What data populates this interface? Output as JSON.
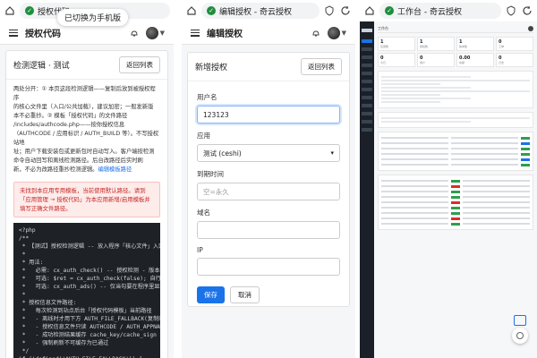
{
  "panel1": {
    "url_title": "授权代码",
    "toast": "已切换为手机版",
    "app_title": "授权代码",
    "card_title": "检测逻辑 · 测试",
    "back_label": "返回列表",
    "desc_line1": "两处分开：① 本页这段检测逻辑——复制后放到被授权程序",
    "desc_line2": "的核心文件里（入口/公共加载），建议加密；一般发新版",
    "desc_line3": "本不必重抄。② 模板「授权代码」的文件路径",
    "desc_line4": "/includes/authcode.php——按你授权信息",
    "desc_line5": "（AUTHCODE / 应用标识 / AUTH_BUILD 等）。不写授权站地",
    "desc_line6": "址；用户下载安装包或更新包时自动写入。客户端按检测",
    "desc_line7": "命令自动回写和离线检测路径。后台改路径后实时刷",
    "desc_line8": "新，不必为改路径重抄检测逻辑。",
    "desc_link": "编辑模板路径",
    "alert_text": "未找到本应用专用模板，当前使用默认路径。请到「应用管理 → 授权代码」为本应用新增/启用模板并填写正确文件路径。",
    "code_lines": [
      "<?php",
      "/**",
      " * 【测试】授权检测逻辑 -- 放入程序「核心文件」入口/公",
      " *",
      " * 用法:",
      " *   必需: cx_auth_check() -- 授权检测 - 版本检",
      " *   可选: $ret = cx_auth_check(false); 自行处",
      " *   可选: cx_auth_ads() -- 仅当勾要在程序里显示",
      " *",
      " * 授权信息文件路径:",
      " *   每次检测到站点后台「授权代码模板」当前路径",
      " *   - 离线时才用下方 AUTH_FILE_FALLBACK(复制时的路",
      " *   - 授权信息文件只读 AUTHCODE / AUTH_APPNAME /",
      " *   - 成功检测结果缓存 cache_key/cache_sign 本地",
      " *   - 强制刷新不可缓存为已通过",
      " */",
      "if (!defined('AUTH_FILE_FALLBACK')) {",
      "    define('AUTH_FILE_FALLBACK', 'includes/au"
    ]
  },
  "panel2": {
    "url_title": "编辑授权 - 奇云授权",
    "app_title": "编辑授权",
    "card_title": "新增授权",
    "back_label": "返回列表",
    "username_label": "用户名",
    "username_value": "123123",
    "app_label": "应用",
    "app_value": "测试 (ceshi)",
    "expire_label": "到期时间",
    "expire_placeholder": "空=永久",
    "domain_label": "域名",
    "domain_value": "",
    "ip_label": "IP",
    "ip_value": "",
    "save_label": "保存",
    "cancel_label": "取消"
  },
  "panel3": {
    "url_title": "工作台 - 奇云授权",
    "stats": [
      {
        "n": "1",
        "l": "应用数"
      },
      {
        "n": "1",
        "l": "授权数"
      },
      {
        "n": "1",
        "l": "版本数"
      },
      {
        "n": "0",
        "l": "工单"
      },
      {
        "n": "0",
        "l": "今日"
      },
      {
        "n": "0",
        "l": "用户"
      },
      {
        "n": "0.00",
        "l": "余额"
      },
      {
        "n": "0",
        "l": "日志"
      }
    ],
    "title": "工作台"
  },
  "colors": {
    "primary": "#1a73e8",
    "danger": "#c62828",
    "success": "#1e8e3e",
    "code_bg": "#1e2227"
  }
}
